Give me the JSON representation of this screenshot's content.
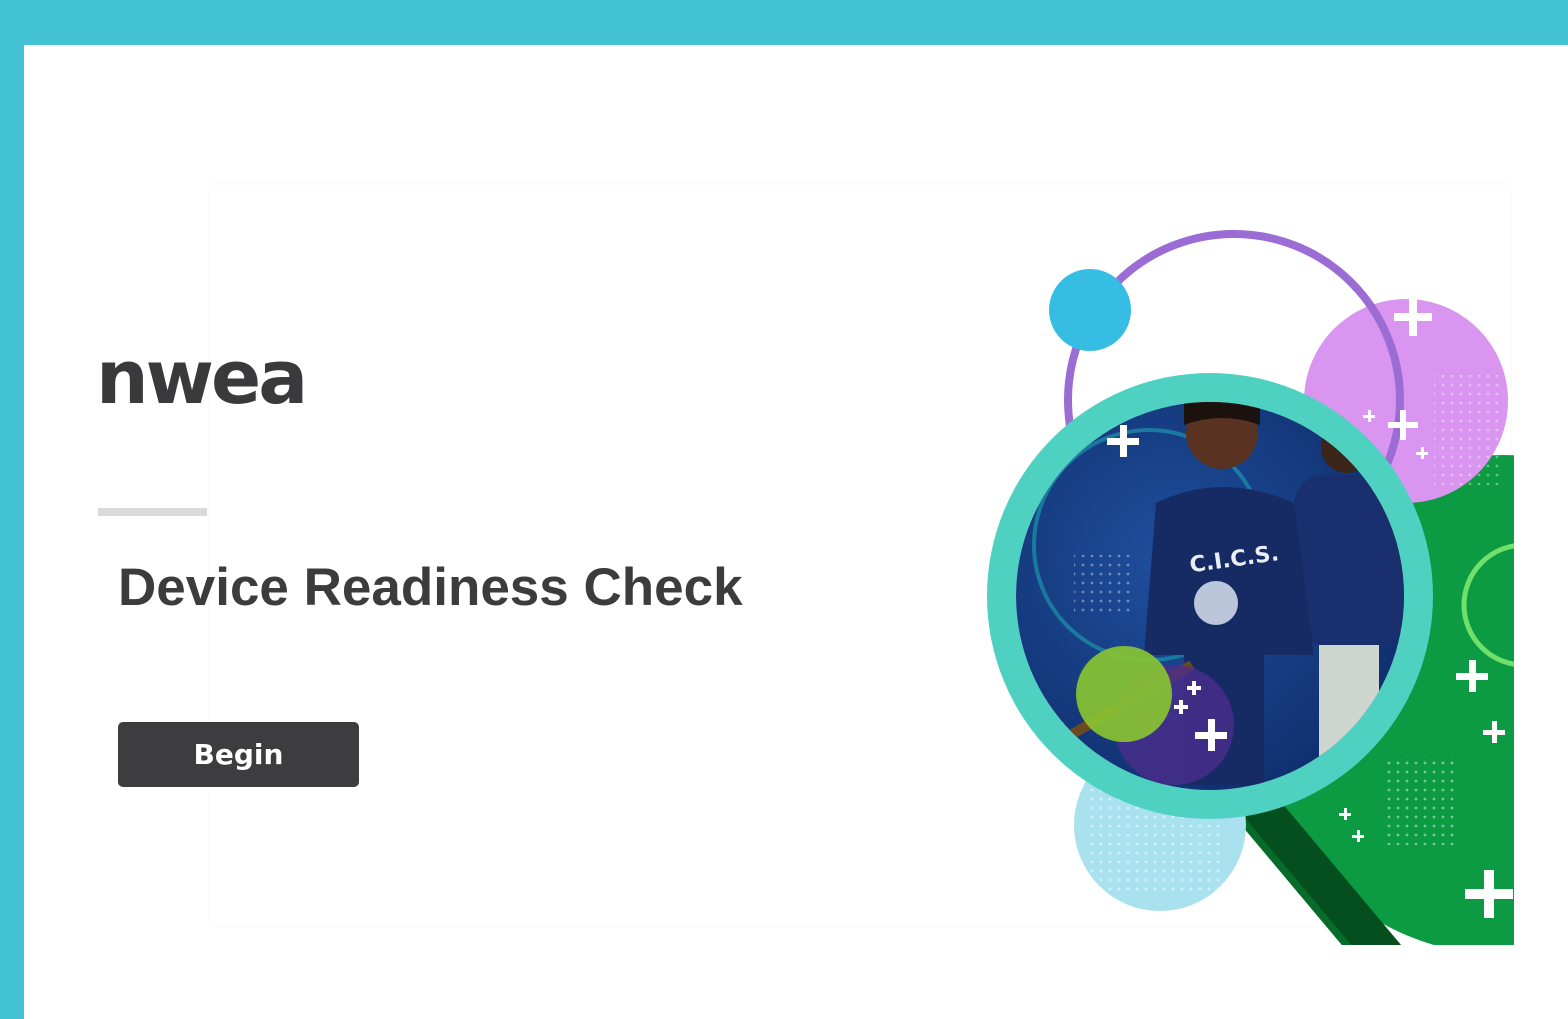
{
  "brand": {
    "logo_text": "nwea",
    "background_color": "#43c2d4",
    "button_color": "#3d3c3e",
    "title_color": "#3c3c3c"
  },
  "page": {
    "title": "Device Readiness Check"
  },
  "actions": {
    "begin_label": "Begin"
  },
  "hero": {
    "shirt_text": "C.I.C.S."
  }
}
